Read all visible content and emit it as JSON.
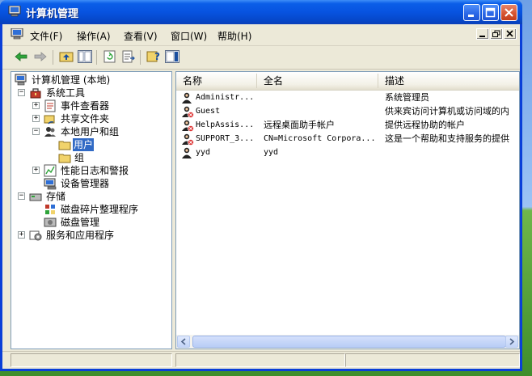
{
  "window": {
    "title": "计算机管理"
  },
  "menubar": {
    "items": [
      "文件(F)",
      "操作(A)",
      "查看(V)",
      "窗口(W)",
      "帮助(H)"
    ]
  },
  "toolbar": {
    "buttons": [
      "back-arrow-icon",
      "forward-arrow-icon",
      "up-folder-icon",
      "show-tree-icon",
      "refresh-icon",
      "export-icon",
      "help-icon",
      "properties-icon"
    ]
  },
  "tree": {
    "root": "计算机管理 (本地)",
    "system_tools": "系统工具",
    "event_viewer": "事件查看器",
    "shared_folders": "共享文件夹",
    "local_users_groups": "本地用户和组",
    "users": "用户",
    "groups": "组",
    "perf_logs": "性能日志和警报",
    "device_manager": "设备管理器",
    "storage": "存储",
    "disk_defrag": "磁盘碎片整理程序",
    "disk_mgmt": "磁盘管理",
    "services_apps": "服务和应用程序"
  },
  "list": {
    "columns": [
      "名称",
      "全名",
      "描述"
    ],
    "rows": [
      {
        "name": "Administr...",
        "fullname": "",
        "desc": "系统管理员",
        "disabled": false
      },
      {
        "name": "Guest",
        "fullname": "",
        "desc": "供来宾访问计算机或访问域的内",
        "disabled": true
      },
      {
        "name": "HelpAssis...",
        "fullname": "远程桌面助手帐户",
        "desc": "提供远程协助的帐户",
        "disabled": true
      },
      {
        "name": "SUPPORT_3...",
        "fullname": "CN=Microsoft Corpora...",
        "desc": "这是一个帮助和支持服务的提供",
        "disabled": true
      },
      {
        "name": "yyd",
        "fullname": "yyd",
        "desc": "",
        "disabled": false
      }
    ]
  },
  "colors": {
    "title_blue": "#0753e0",
    "selection": "#316ac5",
    "close_red": "#d5522f"
  }
}
